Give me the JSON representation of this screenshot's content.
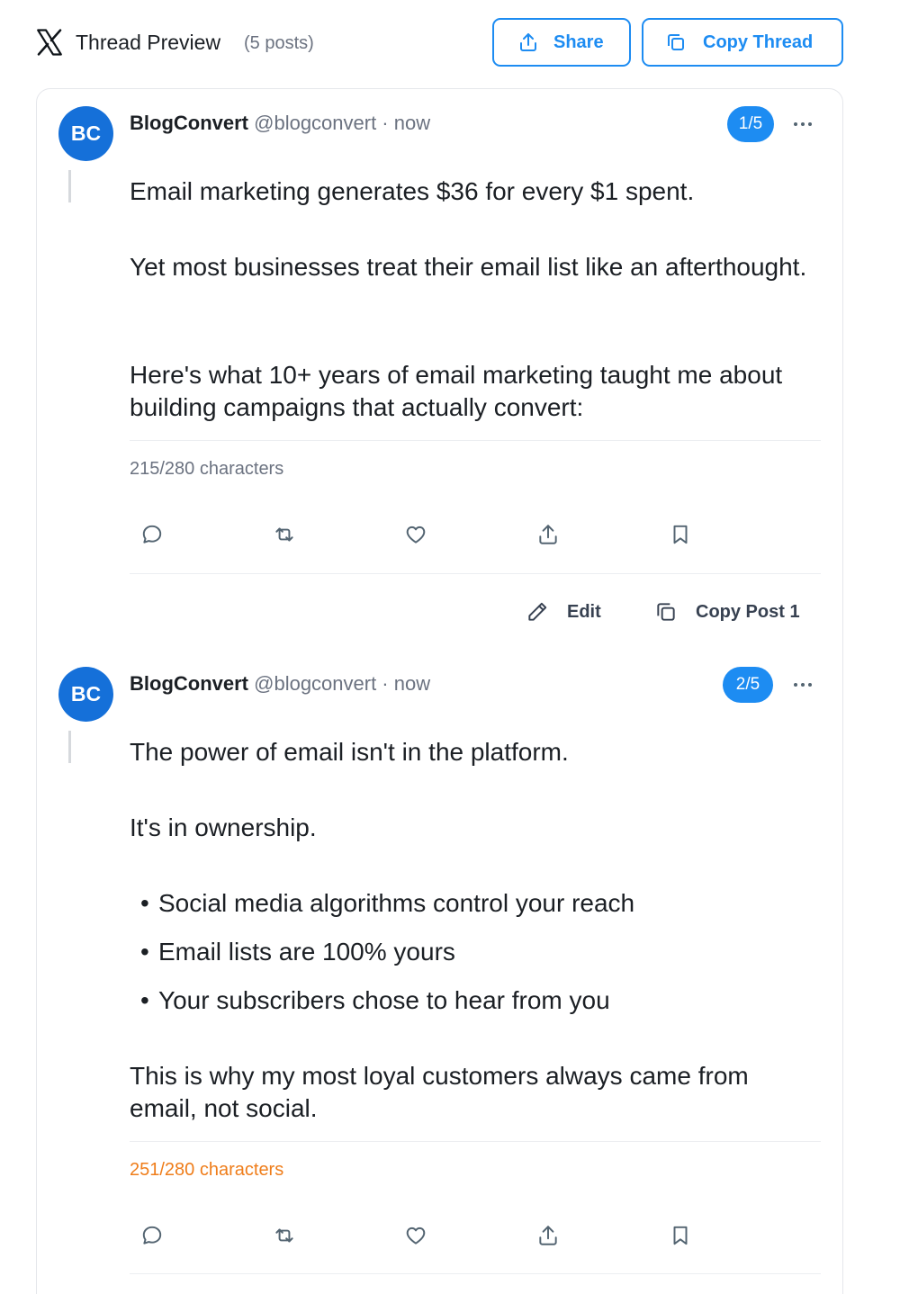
{
  "header": {
    "title": "Thread Preview",
    "count": "(5 posts)",
    "share_label": "Share",
    "copy_thread_label": "Copy Thread"
  },
  "colors": {
    "accent": "#1d8cf2",
    "avatar": "#1570d9",
    "warning": "#ef7d1a",
    "muted": "#6b7280"
  },
  "posts": [
    {
      "avatar_initials": "BC",
      "name": "BlogConvert",
      "handle": "@blogconvert · now",
      "badge": "1/5",
      "paragraphs": [
        "Email marketing generates $36 for every $1 spent.",
        "Yet most businesses treat their email list like an afterthought.",
        "Here's what 10+ years of email marketing taught me about building campaigns that actually convert:"
      ],
      "char_count": "215/280 characters",
      "edit_label": "Edit",
      "copy_label": "Copy Post 1"
    },
    {
      "avatar_initials": "BC",
      "name": "BlogConvert",
      "handle": "@blogconvert · now",
      "badge": "2/5",
      "paragraphs": [
        "The power of email isn't in the platform.",
        "It's in ownership.",
        "This is why my most loyal customers always came from email, not social."
      ],
      "bullets": [
        "Social media algorithms control your reach",
        "Email lists are 100% yours",
        "Your subscribers chose to hear from you"
      ],
      "char_count": "251/280 characters"
    }
  ],
  "icons": {
    "logo": "x-logo-icon",
    "share": "share-icon",
    "copy": "copy-icon",
    "more": "more-horizontal-icon",
    "reply": "reply-icon",
    "repost": "repost-icon",
    "like": "heart-icon",
    "upload": "share-icon",
    "bookmark": "bookmark-icon",
    "edit": "pencil-icon"
  }
}
